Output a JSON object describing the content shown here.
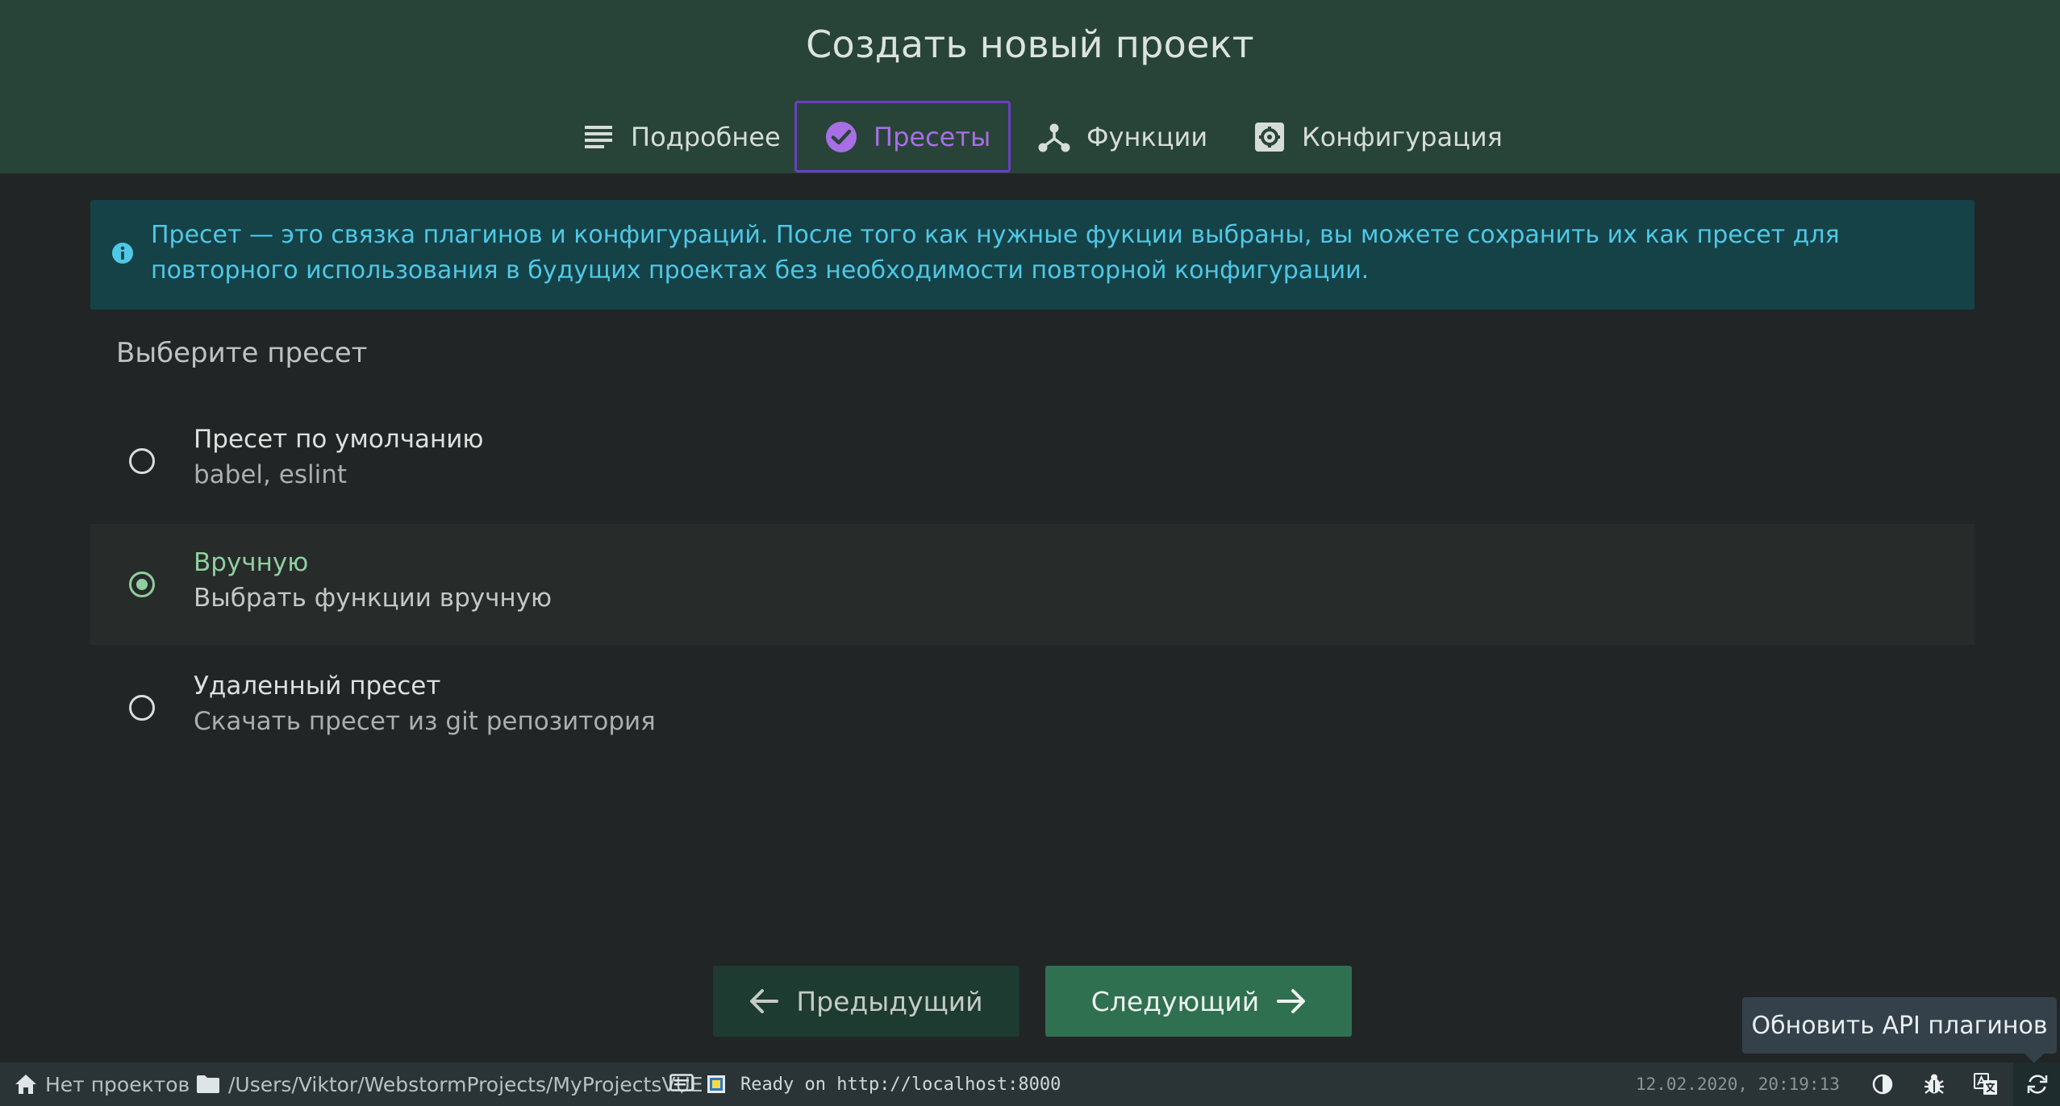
{
  "header": {
    "title": "Создать новый проект",
    "tabs": [
      {
        "label": "Подробнее",
        "icon": "list-icon"
      },
      {
        "label": "Пресеты",
        "icon": "check-circle-icon",
        "active": true
      },
      {
        "label": "Функции",
        "icon": "fork-icon"
      },
      {
        "label": "Конфигурация",
        "icon": "settings-box-icon"
      }
    ]
  },
  "info": {
    "icon": "info-icon",
    "text": "Пресет — это связка плагинов и конфигураций. После того как нужные фукции выбраны, вы можете сохранить их как пресет для повторного использования в будущих проектах без необходимости повторной конфигурации."
  },
  "presets": {
    "title": "Выберите пресет",
    "options": [
      {
        "name": "Пресет по умолчанию",
        "description": "babel, eslint",
        "selected": false
      },
      {
        "name": "Вручную",
        "description": "Выбрать функции вручную",
        "selected": true
      },
      {
        "name": "Удаленный пресет",
        "description": "Скачать пресет из git репозитория",
        "selected": false
      }
    ]
  },
  "buttons": {
    "prev_label": "Предыдущий",
    "next_label": "Следующий"
  },
  "tooltip": {
    "text": "Обновить API плагинов"
  },
  "statusbar": {
    "project": "Нет проектов",
    "path": "/Users/Viktor/WebstormProjects/MyProjectsVUE",
    "log": "Ready on http://localhost:8000",
    "datetime": "12.02.2020, 20:19:13"
  },
  "colors": {
    "header_bg": "#284438",
    "body_bg": "#212525",
    "accent_purple": "#a86ee6",
    "accent_green": "#8fcf9f",
    "info_text": "#4fc8e6",
    "next_button": "#2f7050"
  }
}
